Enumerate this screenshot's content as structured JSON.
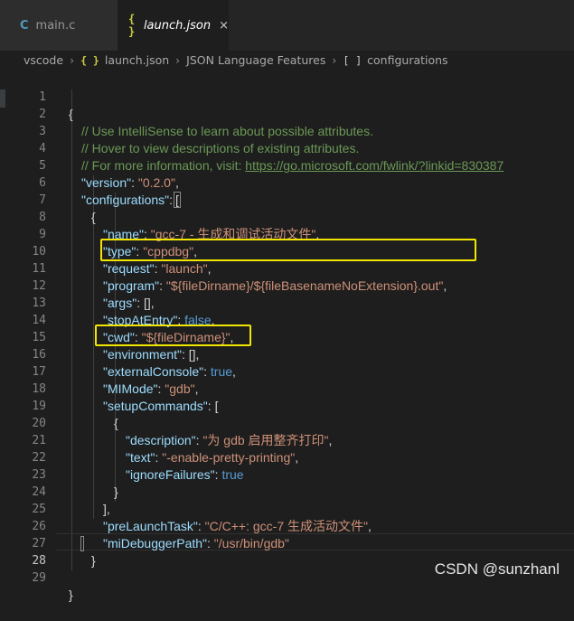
{
  "tabs": [
    {
      "icon": "C",
      "label": "main.c"
    },
    {
      "icon": "{ }",
      "label": "launch.json",
      "close": "×"
    }
  ],
  "breadcrumb": {
    "folder": "vscode",
    "file_icon": "{ }",
    "file": "launch.json",
    "schema": "JSON Language Features",
    "node_icon": "[ ]",
    "node": "configurations",
    "separator": "›"
  },
  "code": {
    "l1": {
      "n": "1",
      "open": "{"
    },
    "l2": {
      "n": "2",
      "comment": "// Use IntelliSense to learn about possible attributes."
    },
    "l3": {
      "n": "3",
      "comment": "// Hover to view descriptions of existing attributes."
    },
    "l4": {
      "n": "4",
      "comment": "// For more information, visit: ",
      "url": "https://go.microsoft.com/fwlink/?linkid=830387"
    },
    "l5": {
      "n": "5",
      "key": "\"version\"",
      "value": "\"0.2.0\""
    },
    "l6": {
      "n": "6",
      "key": "\"configurations\"",
      "bracket": "["
    },
    "l7": {
      "n": "7",
      "open": "{"
    },
    "l8": {
      "n": "8",
      "key": "\"name\"",
      "value": "\"gcc-7 - 生成和调试活动文件\""
    },
    "l9": {
      "n": "9",
      "key": "\"type\"",
      "value": "\"cppdbg\""
    },
    "l10": {
      "n": "10",
      "key": "\"request\"",
      "value": "\"launch\""
    },
    "l11": {
      "n": "11",
      "key": "\"program\"",
      "value": "\"${fileDirname}/${fileBasenameNoExtension}.out\""
    },
    "l12": {
      "n": "12",
      "key": "\"args\"",
      "value": "[]"
    },
    "l13": {
      "n": "13",
      "key": "\"stopAtEntry\"",
      "value": "false"
    },
    "l14": {
      "n": "14",
      "key": "\"cwd\"",
      "value": "\"${fileDirname}\""
    },
    "l15": {
      "n": "15",
      "key": "\"environment\"",
      "value": "[]"
    },
    "l16": {
      "n": "16",
      "key": "\"externalConsole\"",
      "value": "true"
    },
    "l17": {
      "n": "17",
      "key": "\"MIMode\"",
      "value": "\"gdb\""
    },
    "l18": {
      "n": "18",
      "key": "\"setupCommands\"",
      "bracket": "["
    },
    "l19": {
      "n": "19",
      "open": "{"
    },
    "l20": {
      "n": "20",
      "key": "\"description\"",
      "value": "\"为 gdb 启用整齐打印\""
    },
    "l21": {
      "n": "21",
      "key": "\"text\"",
      "value": "\"-enable-pretty-printing\""
    },
    "l22": {
      "n": "22",
      "key": "\"ignoreFailures\"",
      "value": "true"
    },
    "l23": {
      "n": "23",
      "close": "}"
    },
    "l24": {
      "n": "24",
      "close": "],"
    },
    "l25": {
      "n": "25",
      "key": "\"preLaunchTask\"",
      "value": "\"C/C++: gcc-7 生成活动文件\""
    },
    "l26": {
      "n": "26",
      "key": "\"miDebuggerPath\"",
      "value": "\"/usr/bin/gdb\""
    },
    "l27": {
      "n": "27",
      "close": "}"
    },
    "l28": {
      "n": "28"
    },
    "l29": {
      "n": "29",
      "close": "}"
    }
  },
  "watermark": "CSDN @sunzhanl",
  "colors": {
    "key": "#9cdcfe",
    "string": "#ce9178",
    "boolean": "#569cd6",
    "comment": "#6a9955",
    "highlight": "#f2e600"
  }
}
